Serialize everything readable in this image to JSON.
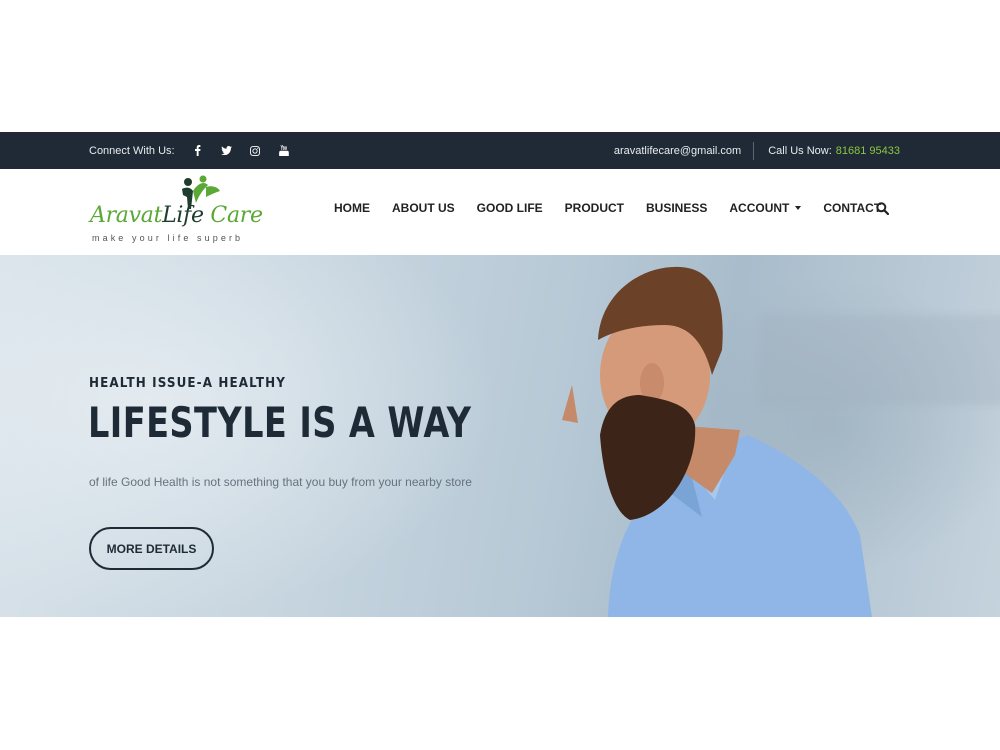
{
  "topbar": {
    "connect_label": "Connect With Us:",
    "social": [
      "facebook-icon",
      "twitter-icon",
      "instagram-icon",
      "youtube-icon"
    ],
    "email": "aravatlifecare@gmail.com",
    "call_label": "Call Us Now:",
    "phone": "81681 95433"
  },
  "logo": {
    "name_green_1": "Aravat",
    "name_dark": "Life",
    "name_green_2": "Care",
    "tagline": "make your life superb"
  },
  "nav": {
    "items": [
      {
        "label": "HOME"
      },
      {
        "label": "ABOUT US"
      },
      {
        "label": "GOOD LIFE"
      },
      {
        "label": "PRODUCT"
      },
      {
        "label": "BUSINESS"
      },
      {
        "label": "ACCOUNT",
        "dropdown": true
      },
      {
        "label": "CONTACT"
      }
    ],
    "search_icon": "search-icon"
  },
  "hero": {
    "eyebrow": "HEALTH ISSUE-A HEALTHY",
    "headline": "LIFESTYLE IS A WAY",
    "subtext": "of life Good Health is not something that you buy from your nearby store",
    "button_label": "MORE DETAILS"
  },
  "colors": {
    "topbar_bg": "#1f2a36",
    "accent_green": "#8cc63f",
    "logo_green": "#5aa836",
    "heading_dark": "#1e2a35"
  }
}
